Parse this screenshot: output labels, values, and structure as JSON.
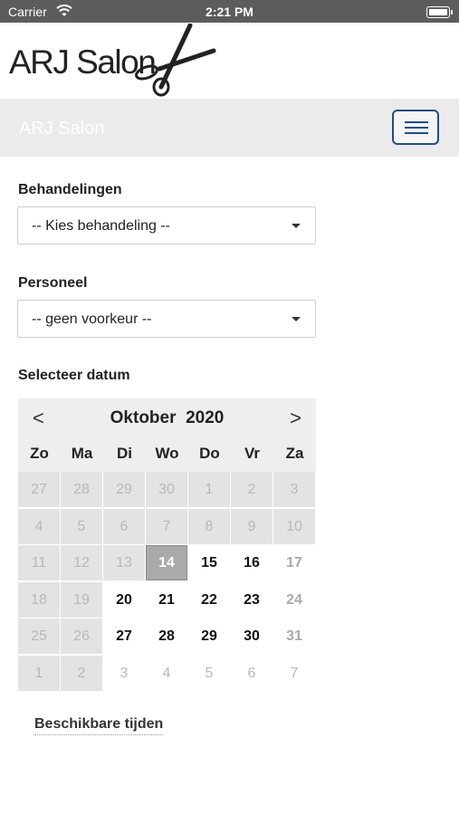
{
  "status_bar": {
    "carrier": "Carrier",
    "time": "2:21 PM"
  },
  "logo": {
    "text": "ARJ Salon",
    "icon": "scissors-icon"
  },
  "navbar": {
    "brand": "ARJ Salon",
    "menu_icon": "hamburger-icon"
  },
  "form": {
    "treatment_label": "Behandelingen",
    "treatment_value": "-- Kies behandeling --",
    "staff_label": "Personeel",
    "staff_value": "-- geen voorkeur --",
    "date_label": "Selecteer datum"
  },
  "calendar": {
    "prev": "<",
    "next": ">",
    "month": "Oktober",
    "year": "2020",
    "weekdays": [
      "Zo",
      "Ma",
      "Di",
      "Wo",
      "Do",
      "Vr",
      "Za"
    ],
    "days": [
      {
        "d": "27",
        "s": "disabled"
      },
      {
        "d": "28",
        "s": "disabled"
      },
      {
        "d": "29",
        "s": "disabled"
      },
      {
        "d": "30",
        "s": "disabled"
      },
      {
        "d": "1",
        "s": "disabled"
      },
      {
        "d": "2",
        "s": "disabled"
      },
      {
        "d": "3",
        "s": "disabled"
      },
      {
        "d": "4",
        "s": "disabled"
      },
      {
        "d": "5",
        "s": "disabled"
      },
      {
        "d": "6",
        "s": "disabled"
      },
      {
        "d": "7",
        "s": "disabled"
      },
      {
        "d": "8",
        "s": "disabled"
      },
      {
        "d": "9",
        "s": "disabled"
      },
      {
        "d": "10",
        "s": "disabled"
      },
      {
        "d": "11",
        "s": "disabled"
      },
      {
        "d": "12",
        "s": "disabled"
      },
      {
        "d": "13",
        "s": "disabled"
      },
      {
        "d": "14",
        "s": "selected"
      },
      {
        "d": "15",
        "s": "avail"
      },
      {
        "d": "16",
        "s": "avail"
      },
      {
        "d": "17",
        "s": "muted"
      },
      {
        "d": "18",
        "s": "disabled"
      },
      {
        "d": "19",
        "s": "disabled"
      },
      {
        "d": "20",
        "s": "avail"
      },
      {
        "d": "21",
        "s": "avail"
      },
      {
        "d": "22",
        "s": "avail"
      },
      {
        "d": "23",
        "s": "avail"
      },
      {
        "d": "24",
        "s": "muted"
      },
      {
        "d": "25",
        "s": "disabled"
      },
      {
        "d": "26",
        "s": "disabled"
      },
      {
        "d": "27",
        "s": "avail"
      },
      {
        "d": "28",
        "s": "avail"
      },
      {
        "d": "29",
        "s": "avail"
      },
      {
        "d": "30",
        "s": "avail"
      },
      {
        "d": "31",
        "s": "muted"
      },
      {
        "d": "1",
        "s": "disabled"
      },
      {
        "d": "2",
        "s": "disabled"
      },
      {
        "d": "3",
        "s": "future"
      },
      {
        "d": "4",
        "s": "future"
      },
      {
        "d": "5",
        "s": "future"
      },
      {
        "d": "6",
        "s": "future"
      },
      {
        "d": "7",
        "s": "future"
      }
    ]
  },
  "available_times_link": "Beschikbare tijden",
  "colors": {
    "accent": "#1f4e85",
    "navbar_bg": "#ebebeb",
    "disabled_day": "#e3e3e3",
    "selected_day": "#aaaaaa"
  }
}
